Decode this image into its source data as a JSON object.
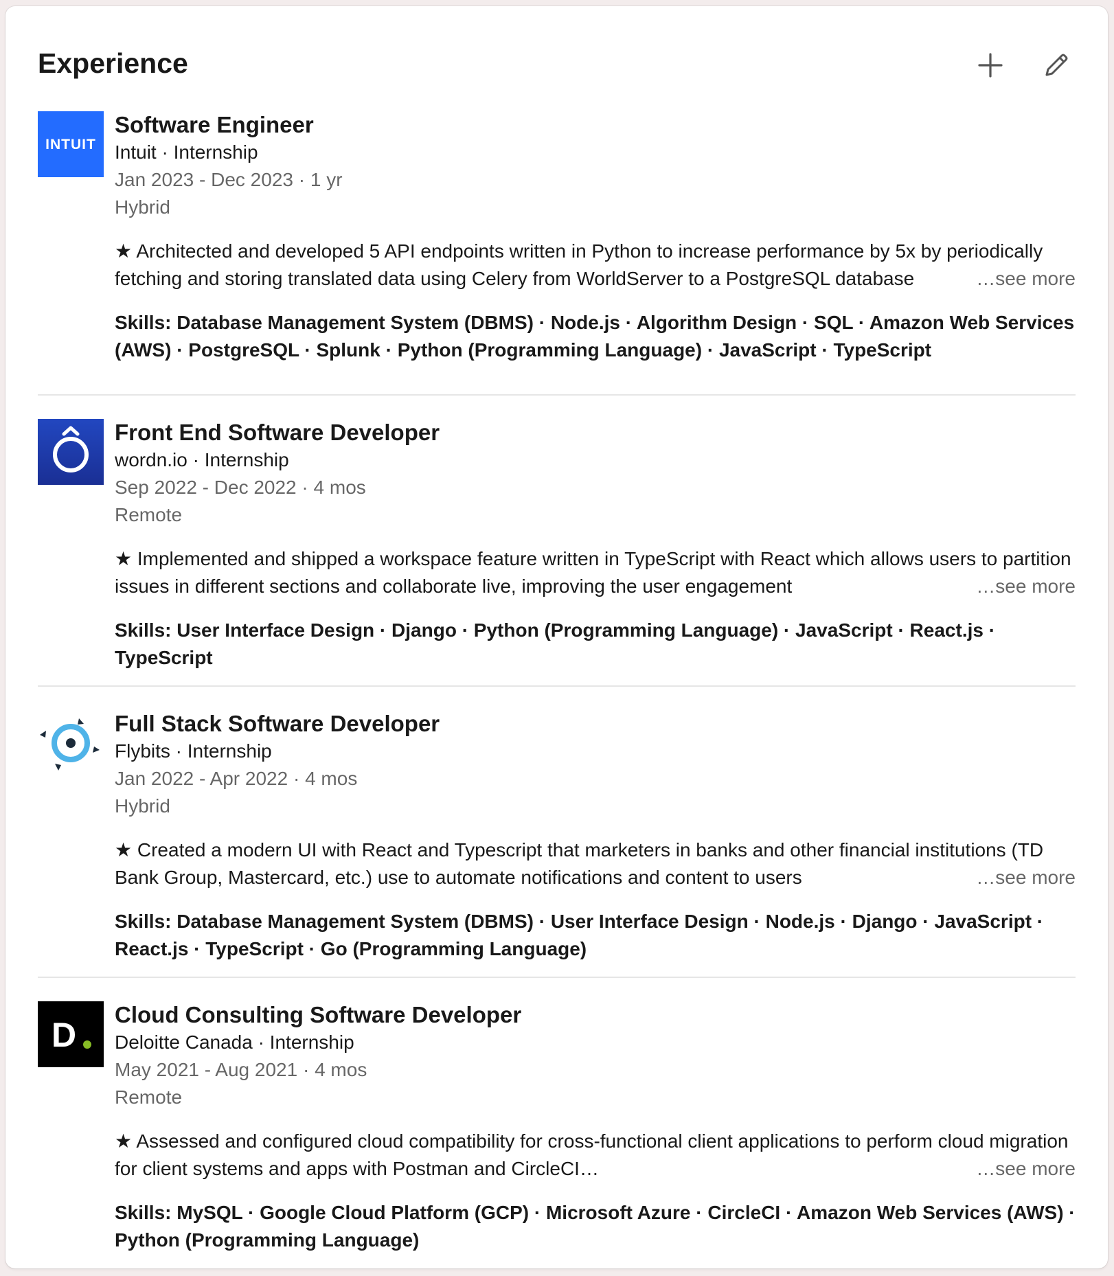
{
  "section": {
    "title": "Experience",
    "add_icon": "plus-icon",
    "edit_icon": "pencil-icon"
  },
  "colors": {
    "intuit_blue": "#236cff",
    "wordn_blue": "#1f3fb0",
    "flybits_blue": "#4fb3e8",
    "deloitte_black": "#000000",
    "deloitte_green": "#86bc25"
  },
  "see_more_label": "…see more",
  "experiences": [
    {
      "logo": "intuit-logo",
      "logo_text": "INTUIT",
      "role": "Software Engineer",
      "company": "Intuit · Internship",
      "dates": "Jan 2023 - Dec 2023 · 1 yr",
      "location": "Hybrid",
      "description": "★ Architected and developed 5 API endpoints written in Python to increase performance by 5x by periodically fetching and storing translated data using Celery from WorldServer to a PostgreSQL database",
      "skills": "Skills: Database Management System (DBMS) · Node.js · Algorithm Design · SQL · Amazon Web Services (AWS) · PostgreSQL · Splunk · Python (Programming Language) · JavaScript · TypeScript"
    },
    {
      "logo": "wordn-logo",
      "role": "Front End Software Developer",
      "company": "wordn.io · Internship",
      "dates": "Sep 2022 - Dec 2022 · 4 mos",
      "location": "Remote",
      "description": "★ Implemented and shipped a workspace feature written in TypeScript with React which allows users to partition issues in different sections and collaborate live, improving the user engagement",
      "skills": "Skills: User Interface Design · Django · Python (Programming Language) · JavaScript · React.js · TypeScript"
    },
    {
      "logo": "flybits-logo",
      "role": "Full Stack Software Developer",
      "company": "Flybits · Internship",
      "dates": "Jan 2022 - Apr 2022 · 4 mos",
      "location": "Hybrid",
      "description": "★ Created a modern UI with React and Typescript that marketers in banks and other financial institutions (TD Bank Group, Mastercard, etc.) use to automate notifications and content to users",
      "skills": "Skills: Database Management System (DBMS) · User Interface Design · Node.js · Django · JavaScript · React.js · TypeScript · Go (Programming Language)"
    },
    {
      "logo": "deloitte-logo",
      "logo_text": "D",
      "role": "Cloud Consulting Software Developer",
      "company": "Deloitte Canada · Internship",
      "dates": "May 2021 - Aug 2021 · 4 mos",
      "location": "Remote",
      "description": "★ Assessed and configured cloud compatibility for cross-functional client applications to perform cloud migration for client systems and apps with Postman and CircleCI…",
      "skills": "Skills: MySQL · Google Cloud Platform (GCP) · Microsoft Azure · CircleCI · Amazon Web Services (AWS) · Python (Programming Language)"
    }
  ]
}
